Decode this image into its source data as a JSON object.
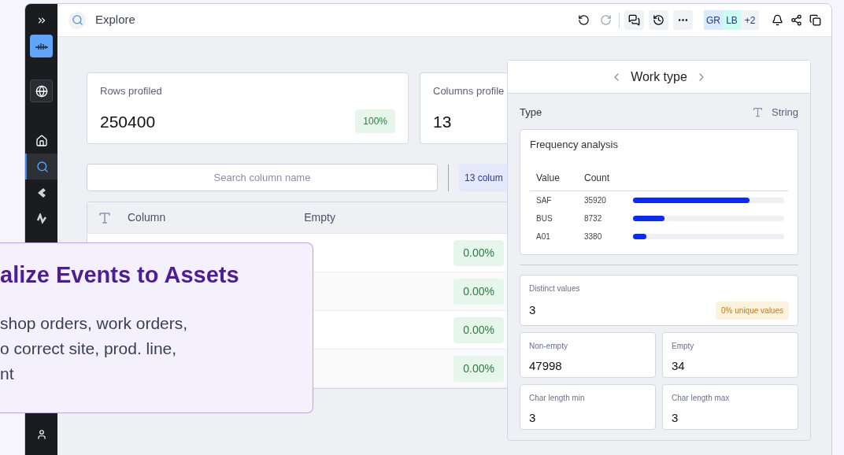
{
  "sidebar": {
    "items": [
      {
        "kind": "expand",
        "selected": false
      },
      {
        "kind": "logo",
        "selected": false
      },
      {
        "kind": "globe",
        "selected": false
      },
      {
        "kind": "home",
        "selected": false
      },
      {
        "kind": "search",
        "selected": true
      },
      {
        "kind": "shape",
        "selected": false
      },
      {
        "kind": "wave",
        "selected": false
      },
      {
        "kind": "user",
        "selected": false
      }
    ]
  },
  "header": {
    "title": "Explore",
    "avatars": [
      {
        "label": "GR",
        "color": "#dbeafe"
      },
      {
        "label": "LB",
        "color": "#ccfbf1"
      },
      {
        "label": "+2",
        "color": "#f1f2f5"
      }
    ]
  },
  "cards": [
    {
      "label": "Rows profiled",
      "value": "250400",
      "badge": "100%"
    },
    {
      "label": "Columns profile",
      "value": "13"
    }
  ],
  "search": {
    "placeholder": "Search column name"
  },
  "columns_button": "13 colum",
  "table": {
    "columns": [
      "Column",
      "Empty"
    ],
    "rows": [
      {
        "empty": "0.00%"
      },
      {
        "empty": "0.00%"
      },
      {
        "empty": "0.00%"
      },
      {
        "empty": "0.00%"
      }
    ]
  },
  "panel": {
    "title": "Work type",
    "type_label": "Type",
    "type_value": "String",
    "frequency": {
      "title": "Frequency analysis",
      "columns": [
        "Value",
        "Count"
      ],
      "rows": [
        {
          "value": "SAF",
          "count": "35920",
          "level": 0.77
        },
        {
          "value": "BUS",
          "count": "8732",
          "level": 0.21
        },
        {
          "value": "A01",
          "count": "3380",
          "level": 0.09
        }
      ]
    },
    "distinct": {
      "label": "Distinct values",
      "value": "3",
      "badge": "0% unique values"
    },
    "stats": [
      {
        "label": "Non-empty",
        "value": "47998"
      },
      {
        "label": "Empty",
        "value": "34"
      },
      {
        "label": "Char length min",
        "value": "3"
      },
      {
        "label": "Char length max",
        "value": "3"
      }
    ]
  },
  "callout": {
    "title": "alize Events to Assets",
    "lines": [
      "shop orders, work orders,",
      "o correct site, prod. line,",
      "nt"
    ]
  }
}
